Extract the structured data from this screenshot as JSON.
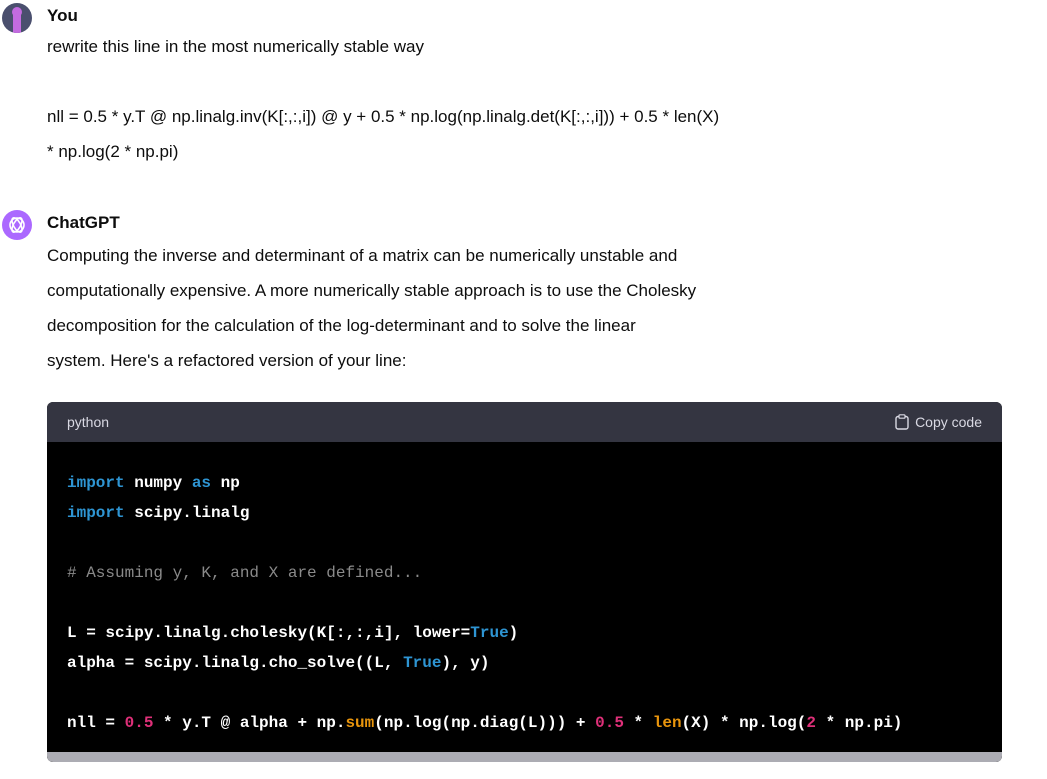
{
  "user": {
    "name": "You",
    "message": [
      "rewrite this line in the most numerically stable way",
      "",
      "nll = 0.5 * y.T @ np.linalg.inv(K[:,:,i]) @ y + 0.5 * np.log(np.linalg.det(K[:,:,i])) + 0.5 * len(X)",
      "* np.log(2 * np.pi)"
    ]
  },
  "assistant": {
    "name": "ChatGPT",
    "message": [
      "Computing the inverse and determinant of a matrix can be numerically unstable and",
      "computationally expensive. A more numerically stable approach is to use the Cholesky",
      "decomposition for the calculation of the log-determinant and to solve the linear",
      "system. Here's a refactored version of your line:"
    ],
    "code_block": {
      "language": "python",
      "copy_label": "Copy code",
      "colors": {
        "keyword": "#2e95d3",
        "comment": "#8a8a8a",
        "number": "#df3079",
        "builtin": "#e9950c",
        "plain": "#ffffff"
      },
      "lines": [
        [
          [
            "keyword",
            "import"
          ],
          [
            "plain",
            " numpy "
          ],
          [
            "keyword",
            "as"
          ],
          [
            "plain",
            " np"
          ]
        ],
        [
          [
            "keyword",
            "import"
          ],
          [
            "plain",
            " scipy.linalg"
          ]
        ],
        [],
        [
          [
            "comment",
            "# Assuming y, K, and X are defined..."
          ]
        ],
        [],
        [
          [
            "plain",
            "L = scipy.linalg.cholesky(K[:,:,i], lower="
          ],
          [
            "keyword",
            "True"
          ],
          [
            "plain",
            ")"
          ]
        ],
        [
          [
            "plain",
            "alpha = scipy.linalg.cho_solve((L, "
          ],
          [
            "keyword",
            "True"
          ],
          [
            "plain",
            "), y)"
          ]
        ],
        [],
        [
          [
            "plain",
            "nll = "
          ],
          [
            "number",
            "0.5"
          ],
          [
            "plain",
            " * y.T @ alpha + np."
          ],
          [
            "builtin",
            "sum"
          ],
          [
            "plain",
            "(np.log(np.diag(L))) + "
          ],
          [
            "number",
            "0.5"
          ],
          [
            "plain",
            " * "
          ],
          [
            "builtin",
            "len"
          ],
          [
            "plain",
            "(X) * np.log("
          ],
          [
            "number",
            "2"
          ],
          [
            "plain",
            " * np.pi)"
          ]
        ]
      ]
    }
  }
}
